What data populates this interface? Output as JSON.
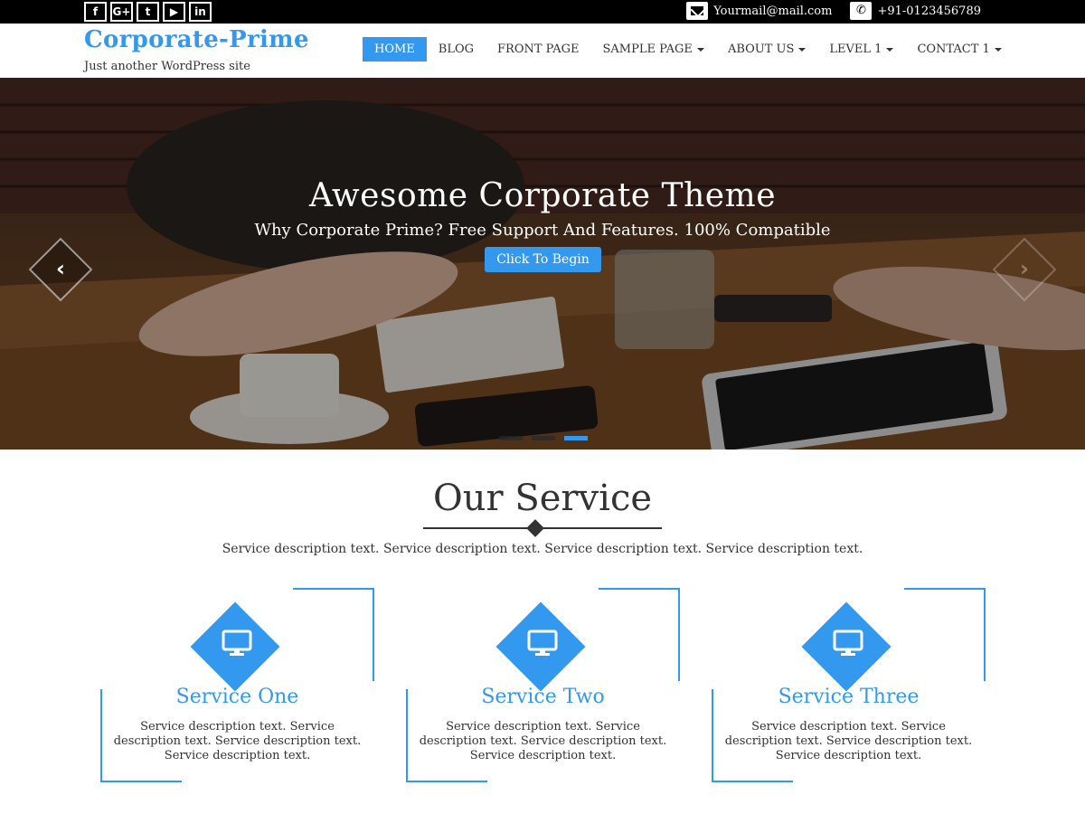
{
  "topbar": {
    "social": [
      {
        "icon": "facebook-icon",
        "glyph": "f"
      },
      {
        "icon": "google-plus-icon",
        "glyph": "G+"
      },
      {
        "icon": "twitter-icon",
        "glyph": "t"
      },
      {
        "icon": "youtube-icon",
        "glyph": "▶"
      },
      {
        "icon": "linkedin-icon",
        "glyph": "in"
      }
    ],
    "email": "Yourmail@mail.com",
    "phone": "+91-0123456789"
  },
  "header": {
    "site_title": "Corporate-Prime",
    "tagline": "Just another WordPress site"
  },
  "nav": {
    "items": [
      {
        "label": "HOME",
        "active": true,
        "dropdown": false
      },
      {
        "label": "BLOG",
        "active": false,
        "dropdown": false
      },
      {
        "label": "FRONT PAGE",
        "active": false,
        "dropdown": false
      },
      {
        "label": "SAMPLE PAGE",
        "active": false,
        "dropdown": true
      },
      {
        "label": "ABOUT US",
        "active": false,
        "dropdown": true
      },
      {
        "label": "LEVEL 1",
        "active": false,
        "dropdown": true
      },
      {
        "label": "CONTACT 1",
        "active": false,
        "dropdown": true
      }
    ]
  },
  "hero": {
    "title": "Awesome Corporate Theme",
    "subtitle": "Why Corporate Prime? Free Support And Features. 100% Compatible",
    "button": "Click To Begin",
    "prev_glyph": "‹",
    "next_glyph": "›",
    "slides": 3,
    "active_slide": 3
  },
  "services": {
    "title": "Our Service",
    "description": "Service description text. Service description text. Service description text. Service description text.",
    "items": [
      {
        "title": "Service One",
        "text": "Service description text. Service description text. Service description text. Service description text.",
        "icon": "monitor-icon"
      },
      {
        "title": "Service Two",
        "text": "Service description text. Service description text. Service description text. Service description text.",
        "icon": "monitor-icon"
      },
      {
        "title": "Service Three",
        "text": "Service description text. Service description text. Service description text. Service description text.",
        "icon": "monitor-icon"
      }
    ]
  },
  "colors": {
    "accent": "#3399ee",
    "topbar": "#000000",
    "text": "#333333"
  }
}
